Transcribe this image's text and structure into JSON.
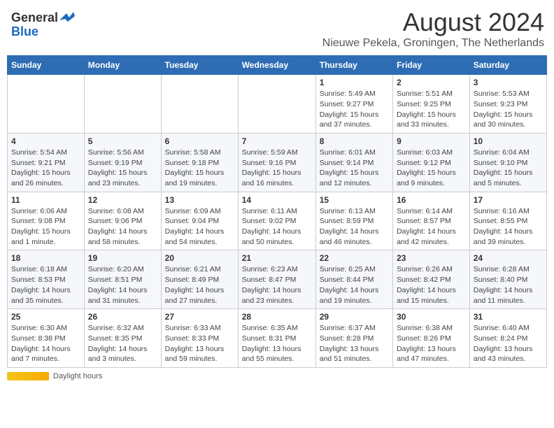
{
  "logo": {
    "line1": "General",
    "line2": "Blue"
  },
  "title": "August 2024",
  "subtitle": "Nieuwe Pekela, Groningen, The Netherlands",
  "footer": {
    "daylight_label": "Daylight hours"
  },
  "weekdays": [
    "Sunday",
    "Monday",
    "Tuesday",
    "Wednesday",
    "Thursday",
    "Friday",
    "Saturday"
  ],
  "weeks": [
    [
      {
        "day": "",
        "info": ""
      },
      {
        "day": "",
        "info": ""
      },
      {
        "day": "",
        "info": ""
      },
      {
        "day": "",
        "info": ""
      },
      {
        "day": "1",
        "info": "Sunrise: 5:49 AM\nSunset: 9:27 PM\nDaylight: 15 hours and 37 minutes."
      },
      {
        "day": "2",
        "info": "Sunrise: 5:51 AM\nSunset: 9:25 PM\nDaylight: 15 hours and 33 minutes."
      },
      {
        "day": "3",
        "info": "Sunrise: 5:53 AM\nSunset: 9:23 PM\nDaylight: 15 hours and 30 minutes."
      }
    ],
    [
      {
        "day": "4",
        "info": "Sunrise: 5:54 AM\nSunset: 9:21 PM\nDaylight: 15 hours and 26 minutes."
      },
      {
        "day": "5",
        "info": "Sunrise: 5:56 AM\nSunset: 9:19 PM\nDaylight: 15 hours and 23 minutes."
      },
      {
        "day": "6",
        "info": "Sunrise: 5:58 AM\nSunset: 9:18 PM\nDaylight: 15 hours and 19 minutes."
      },
      {
        "day": "7",
        "info": "Sunrise: 5:59 AM\nSunset: 9:16 PM\nDaylight: 15 hours and 16 minutes."
      },
      {
        "day": "8",
        "info": "Sunrise: 6:01 AM\nSunset: 9:14 PM\nDaylight: 15 hours and 12 minutes."
      },
      {
        "day": "9",
        "info": "Sunrise: 6:03 AM\nSunset: 9:12 PM\nDaylight: 15 hours and 9 minutes."
      },
      {
        "day": "10",
        "info": "Sunrise: 6:04 AM\nSunset: 9:10 PM\nDaylight: 15 hours and 5 minutes."
      }
    ],
    [
      {
        "day": "11",
        "info": "Sunrise: 6:06 AM\nSunset: 9:08 PM\nDaylight: 15 hours and 1 minute."
      },
      {
        "day": "12",
        "info": "Sunrise: 6:08 AM\nSunset: 9:06 PM\nDaylight: 14 hours and 58 minutes."
      },
      {
        "day": "13",
        "info": "Sunrise: 6:09 AM\nSunset: 9:04 PM\nDaylight: 14 hours and 54 minutes."
      },
      {
        "day": "14",
        "info": "Sunrise: 6:11 AM\nSunset: 9:02 PM\nDaylight: 14 hours and 50 minutes."
      },
      {
        "day": "15",
        "info": "Sunrise: 6:13 AM\nSunset: 8:59 PM\nDaylight: 14 hours and 46 minutes."
      },
      {
        "day": "16",
        "info": "Sunrise: 6:14 AM\nSunset: 8:57 PM\nDaylight: 14 hours and 42 minutes."
      },
      {
        "day": "17",
        "info": "Sunrise: 6:16 AM\nSunset: 8:55 PM\nDaylight: 14 hours and 39 minutes."
      }
    ],
    [
      {
        "day": "18",
        "info": "Sunrise: 6:18 AM\nSunset: 8:53 PM\nDaylight: 14 hours and 35 minutes."
      },
      {
        "day": "19",
        "info": "Sunrise: 6:20 AM\nSunset: 8:51 PM\nDaylight: 14 hours and 31 minutes."
      },
      {
        "day": "20",
        "info": "Sunrise: 6:21 AM\nSunset: 8:49 PM\nDaylight: 14 hours and 27 minutes."
      },
      {
        "day": "21",
        "info": "Sunrise: 6:23 AM\nSunset: 8:47 PM\nDaylight: 14 hours and 23 minutes."
      },
      {
        "day": "22",
        "info": "Sunrise: 6:25 AM\nSunset: 8:44 PM\nDaylight: 14 hours and 19 minutes."
      },
      {
        "day": "23",
        "info": "Sunrise: 6:26 AM\nSunset: 8:42 PM\nDaylight: 14 hours and 15 minutes."
      },
      {
        "day": "24",
        "info": "Sunrise: 6:28 AM\nSunset: 8:40 PM\nDaylight: 14 hours and 11 minutes."
      }
    ],
    [
      {
        "day": "25",
        "info": "Sunrise: 6:30 AM\nSunset: 8:38 PM\nDaylight: 14 hours and 7 minutes."
      },
      {
        "day": "26",
        "info": "Sunrise: 6:32 AM\nSunset: 8:35 PM\nDaylight: 14 hours and 3 minutes."
      },
      {
        "day": "27",
        "info": "Sunrise: 6:33 AM\nSunset: 8:33 PM\nDaylight: 13 hours and 59 minutes."
      },
      {
        "day": "28",
        "info": "Sunrise: 6:35 AM\nSunset: 8:31 PM\nDaylight: 13 hours and 55 minutes."
      },
      {
        "day": "29",
        "info": "Sunrise: 6:37 AM\nSunset: 8:28 PM\nDaylight: 13 hours and 51 minutes."
      },
      {
        "day": "30",
        "info": "Sunrise: 6:38 AM\nSunset: 8:26 PM\nDaylight: 13 hours and 47 minutes."
      },
      {
        "day": "31",
        "info": "Sunrise: 6:40 AM\nSunset: 8:24 PM\nDaylight: 13 hours and 43 minutes."
      }
    ]
  ]
}
